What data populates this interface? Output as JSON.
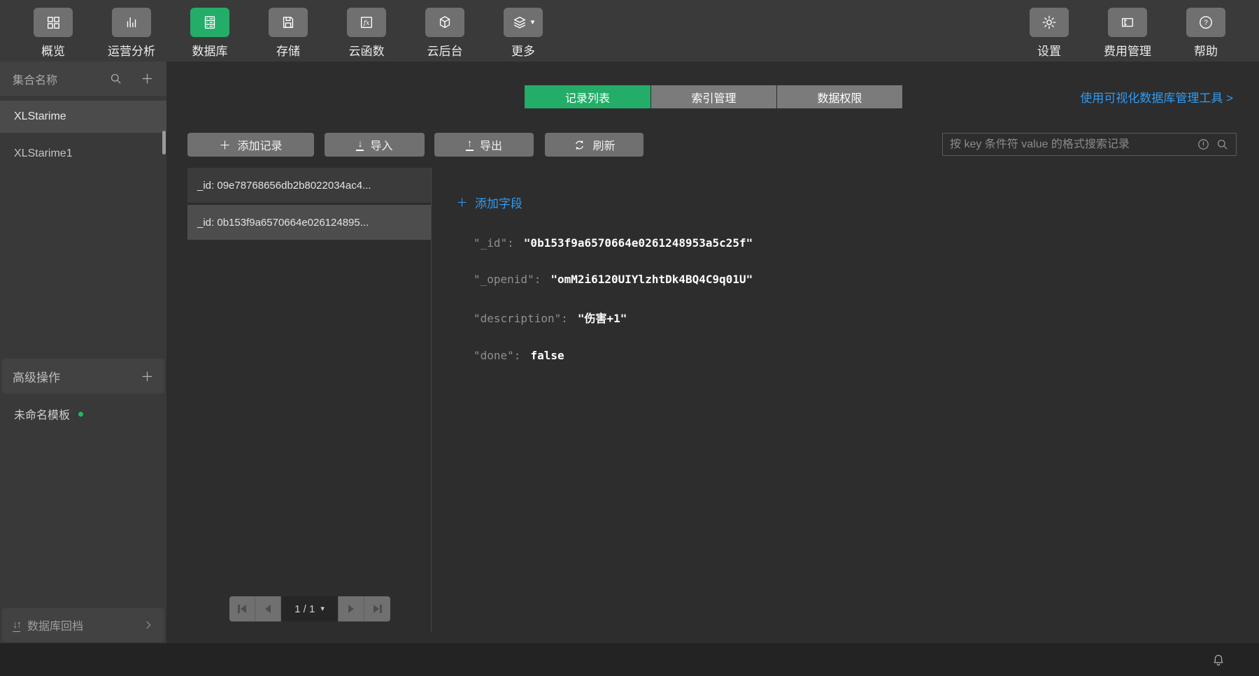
{
  "header": {
    "nav_items": [
      {
        "label": "概览",
        "icon": "grid-icon",
        "active": false
      },
      {
        "label": "运营分析",
        "icon": "bar-chart-icon",
        "active": false
      },
      {
        "label": "数据库",
        "icon": "database-icon",
        "active": true
      },
      {
        "label": "存储",
        "icon": "save-icon",
        "active": false
      },
      {
        "label": "云函数",
        "icon": "fx-icon",
        "active": false
      },
      {
        "label": "云后台",
        "icon": "cube-icon",
        "active": false
      },
      {
        "label": "更多",
        "icon": "layers-icon",
        "has_dropdown": true,
        "active": false
      }
    ],
    "right_items": [
      {
        "label": "设置",
        "icon": "gear-icon"
      },
      {
        "label": "费用管理",
        "icon": "billing-icon"
      },
      {
        "label": "帮助",
        "icon": "help-icon"
      }
    ]
  },
  "sidebar": {
    "collections_header": "集合名称",
    "collections": [
      {
        "name": "XLStarime",
        "selected": true
      },
      {
        "name": "XLStarime1",
        "selected": false
      }
    ],
    "advanced_header": "高级操作",
    "template_item": {
      "name": "未命名模板",
      "status_dot_color": "#2bb167"
    },
    "rollback_label": "数据库回档"
  },
  "main": {
    "tabs": [
      {
        "label": "记录列表",
        "active": true
      },
      {
        "label": "索引管理",
        "active": false
      },
      {
        "label": "数据权限",
        "active": false
      }
    ],
    "visual_tool_link": "使用可视化数据库管理工具 >",
    "toolbar": {
      "add_record": "添加记录",
      "import": "导入",
      "export": "导出",
      "refresh": "刷新",
      "search_placeholder": "按 key 条件符 value 的格式搜索记录"
    },
    "records": [
      {
        "summary": "_id: 09e78768656db2b8022034ac4...",
        "selected": false
      },
      {
        "summary": "_id: 0b153f9a6570664e026124895...",
        "selected": true
      }
    ],
    "pagination": {
      "page_label": "1 / 1"
    },
    "detail": {
      "add_field_label": "添加字段",
      "fields": [
        {
          "key": "\"_id\":",
          "value": "\"0b153f9a6570664e0261248953a5c25f\""
        },
        {
          "key": "\"_openid\":",
          "value": "\"omM2i6120UIYlzhtDk4BQ4C9q01U\""
        },
        {
          "key": "\"description\":",
          "value": "\"伤害+1\""
        },
        {
          "key": "\"done\":",
          "value": "false"
        }
      ]
    }
  },
  "icons": {
    "fx_label": "fx",
    "help_glyph": "?",
    "import_arrow": "↓",
    "export_arrow": "↑",
    "rollback_arrows": "↓↑",
    "more_caret": "▾",
    "page_caret": "▾"
  },
  "colors": {
    "accent_green": "#23ad68",
    "link_blue": "#2f9bf2",
    "status_dot_green": "#2bb167"
  }
}
